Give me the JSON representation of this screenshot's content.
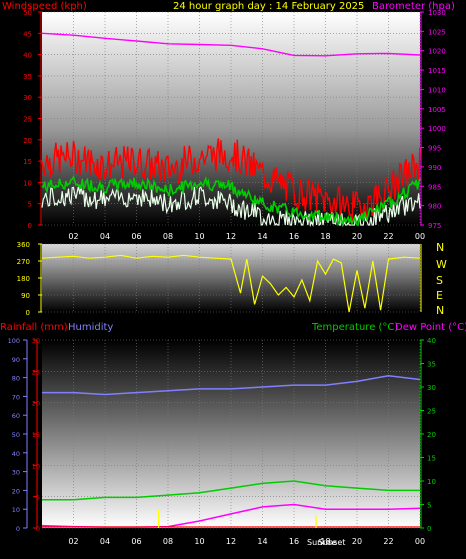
{
  "header": {
    "left_label": "Windspeed (kph)",
    "center_label": "24 hour graph day : 14 February 2025",
    "right_label": "Barometer (hpa)"
  },
  "colors": {
    "background": "#000000",
    "wind_label": "#ff0000",
    "title": "#ffff00",
    "barometer": "#ff00ff",
    "rain_axis": "#ff0000",
    "humidity": "#8080ff",
    "temperature": "#00cc00",
    "dew_point": "#ff00ff",
    "direction": "#ffff00",
    "text": "#ffffff"
  },
  "direction_labels": [
    "N",
    "W",
    "S",
    "E",
    "N"
  ],
  "bottom_header": {
    "rainfall": "Rainfall (mm)",
    "humidity": "Humidity",
    "temperature": "Temperature (°C)",
    "dew_point": "Dew Point (°C)"
  },
  "markers": {
    "sunrise": "Sunrise",
    "sunset": "Sunset"
  },
  "chart_data": [
    {
      "type": "line",
      "title": "24 hour graph day : 14 February 2025",
      "x_ticks": [
        "02",
        "04",
        "06",
        "08",
        "10",
        "12",
        "14",
        "16",
        "18",
        "20",
        "22",
        "00"
      ],
      "y_left": {
        "label": "Windspeed (kph)",
        "range": [
          0,
          50
        ],
        "ticks": [
          "0",
          "5",
          "10",
          "15",
          "20",
          "25",
          "30",
          "35",
          "40",
          "45",
          "50"
        ]
      },
      "y_right": {
        "label": "Barometer (hpa)",
        "range": [
          975,
          1030
        ],
        "ticks": [
          "975",
          "980",
          "985",
          "990",
          "995",
          "1000",
          "1005",
          "1010",
          "1015",
          "1020",
          "1025",
          "1030"
        ]
      },
      "x": [
        0,
        2,
        4,
        6,
        8,
        10,
        12,
        14,
        16,
        18,
        20,
        22,
        24
      ],
      "series": [
        {
          "name": "Barometer (hpa)",
          "values": [
            1024.5,
            1024.0,
            1023.2,
            1022.5,
            1021.8,
            1021.6,
            1021.4,
            1020.5,
            1018.8,
            1018.7,
            1019.2,
            1019.3,
            1018.9
          ]
        },
        {
          "values": [
            15,
            16,
            14,
            15,
            13,
            16,
            17,
            12,
            8,
            6,
            4,
            8,
            15
          ]
        },
        {
          "values": [
            9,
            10,
            9,
            10,
            8,
            10,
            9,
            5,
            3,
            2,
            1,
            5,
            10
          ]
        },
        {
          "values": [
            6,
            7,
            6,
            7,
            5,
            7,
            5,
            2,
            1,
            1,
            0,
            3,
            6
          ]
        }
      ]
    },
    {
      "type": "line",
      "y_ticks": [
        "0",
        "90",
        "180",
        "270",
        "360"
      ],
      "range": [
        0,
        360
      ],
      "x": [
        0,
        1,
        2,
        3,
        4,
        5,
        6,
        7,
        8,
        9,
        10,
        11,
        12,
        12.6,
        13,
        13.5,
        14,
        14.5,
        15,
        15.5,
        16,
        16.5,
        17,
        17.5,
        18,
        18.5,
        19,
        19.5,
        20,
        20.5,
        21,
        21.5,
        22,
        23,
        24
      ],
      "values": [
        285,
        290,
        295,
        285,
        290,
        300,
        285,
        295,
        290,
        300,
        290,
        285,
        280,
        100,
        280,
        40,
        190,
        150,
        90,
        130,
        80,
        170,
        60,
        270,
        200,
        280,
        260,
        0,
        220,
        20,
        270,
        10,
        280,
        290,
        285
      ]
    },
    {
      "type": "line",
      "x_ticks": [
        "02",
        "04",
        "06",
        "08",
        "10",
        "12",
        "14",
        "16",
        "18",
        "20",
        "22",
        "00"
      ],
      "y_left_outer": {
        "label": "Humidity",
        "range": [
          0,
          100
        ],
        "ticks": [
          "0",
          "10",
          "20",
          "30",
          "40",
          "50",
          "60",
          "70",
          "80",
          "90",
          "100"
        ]
      },
      "y_left_inner": {
        "label": "Rainfall (mm)",
        "range": [
          0,
          30
        ],
        "ticks": [
          "0",
          "5",
          "10",
          "15",
          "20",
          "25",
          "30"
        ]
      },
      "y_right": {
        "label": "Temperature (°C) / Dew Point (°C)",
        "range": [
          0,
          40
        ],
        "ticks": [
          "0",
          "5",
          "10",
          "15",
          "20",
          "25",
          "30",
          "35",
          "40"
        ]
      },
      "x": [
        0,
        2,
        4,
        6,
        8,
        10,
        12,
        14,
        16,
        18,
        20,
        22,
        24
      ],
      "series": [
        {
          "name": "Humidity",
          "values": [
            72,
            72,
            71,
            72,
            73,
            74,
            74,
            75,
            76,
            76,
            78,
            81,
            79
          ]
        },
        {
          "name": "Temperature (°C)",
          "values": [
            6,
            6,
            6.5,
            6.5,
            7,
            7.5,
            8.5,
            9.5,
            10,
            9,
            8.5,
            8,
            8
          ]
        },
        {
          "name": "Dew Point (°C)",
          "values": [
            0.5,
            0.3,
            0.2,
            0.2,
            0.3,
            1.5,
            3,
            4.5,
            5,
            4,
            4,
            4,
            4.2
          ]
        }
      ],
      "rain_spikes": [
        {
          "x": 7.4,
          "value": 3
        },
        {
          "x": 17.4,
          "value": 2
        }
      ]
    }
  ]
}
